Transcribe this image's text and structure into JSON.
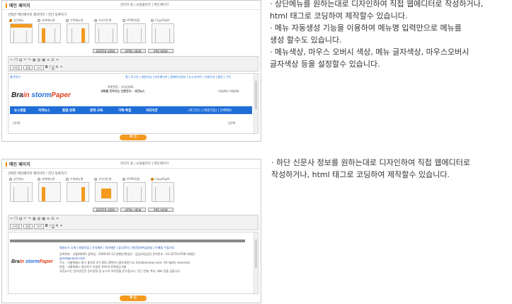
{
  "screenshots": [
    {
      "title": "메인 페이지",
      "breadcrumb": "관리자 홈 | 쇼핑몰관리 | 메인페이지",
      "subtitle": "선택한 메인페이지 레이아웃 / 전단 등록하기",
      "templates": [
        {
          "label": "상단메뉴",
          "selected": true
        },
        {
          "label": "좌측메뉴형",
          "selected": false
        },
        {
          "label": "우측메뉴형",
          "selected": false
        },
        {
          "label": "기사하단형",
          "selected": false
        },
        {
          "label": "HTML편집",
          "selected": false
        },
        {
          "label": "CopyRight",
          "selected": false
        }
      ],
      "tabs": [
        "EDITER VIEW",
        "HTML VIEW",
        "PRE VIEW"
      ],
      "toolbar": {
        "font": "스타일",
        "face": "굴림",
        "size": "크기"
      },
      "preview": {
        "left_link": "즐겨찾기",
        "top_links": "홈 | 로그인 | 회원가입 | 마이페이지 | 홈페이지정보 | 뉴스사이트 | 이용안내 | 웹진 | 구독",
        "tagline_line1": "최종편집 : (오늘날짜)",
        "tagline_line2": "새해를 전하자는 언론전자 - 국민뉴스",
        "right_info": "(새날짜)   (새날짜)",
        "menu": [
          "뉴스종합",
          "지역뉴스",
          "칼럼·연재",
          "문화·교육",
          "기획·특집",
          "국민의견"
        ],
        "menu_right": "(로그인) | (회원가입) | 전체메뉴",
        "footer_left": "(순위)",
        "footer_right": "(검색)"
      },
      "ok_label": "확 인"
    },
    {
      "title": "메인 페이지",
      "breadcrumb": "관리자 홈 | 쇼핑몰관리 | 메인페이지",
      "subtitle": "선택한 메인페이지 레이아웃 / 전단 등록하기",
      "templates": [
        {
          "label": "상단메뉴",
          "selected": false
        },
        {
          "label": "좌측메뉴형",
          "selected": false
        },
        {
          "label": "우측메뉴형",
          "selected": false
        },
        {
          "label": "기사하단형",
          "selected": false
        },
        {
          "label": "HTML편집",
          "selected": false
        },
        {
          "label": "CopyRight",
          "selected": true
        }
      ],
      "tabs": [
        "EDITER VIEW",
        "HTML VIEW",
        "PRE VIEW"
      ],
      "toolbar": {
        "font": "스타일",
        "face": "굴림",
        "size": "크기"
      },
      "preview": {
        "footer_links": "회원뉴스 소개 | 회원모집 | 기사제보 | 독자제안 | 광고문의 | 개인정보취급방침 | 이메일 수집거부",
        "info1": "등록번호 : 서울00001  등록일 : 2009-05-12  발행인/편집인 : 김담비/김성전  문자번호 : 02-2276-6768  이메일 :",
        "info2": "gsnet@naver.com",
        "info3": "주소 : 서울특별시 중구 충무로 4가 261-29번지 (충무회관) (c) Gsnbionnews.com. All rights reserved.",
        "info4": "본점 : 서울특별시 용산로구 모정동 459-4 만화빌딩 4층",
        "info5": "국민뉴스는 인터넷신문 윤리강령 및 뉴스의 저작권을 준수합니다. 무단 전재, 복사, 배포 등을 금합니다."
      },
      "ok_label": "확 인"
    }
  ],
  "logo": {
    "brain": "Bra",
    "in": "in",
    "storm": "storm",
    "paper": "Paper"
  },
  "descriptions": {
    "block1": [
      "· 상단메뉴를 원하는대로 디자인하여 직접 웹에디터로 작성하거나,",
      "html 태그로 코딩하여 제작할수 있습니다.",
      "· 메뉴 자동생성 기능을 이용하여 메뉴명 입력만으로 메뉴를",
      "생성 할수도 있습니다.",
      "· 메뉴색상, 마우스 오버시 색상, 메뉴 글자색상, 마우스오버시",
      "글자색상 등을 설정할수 있습니다."
    ],
    "block2": [
      "· 하단 신문사 정보를 원하는대로 디자인하여 직접 웹에디터로",
      "작성하거나, html 태그로 코딩하여 제작할수 있습니다."
    ]
  },
  "colors": {
    "accent": "#f39a1f",
    "menu_bg": "#1f6ed8",
    "logo_red": "#e3401f"
  }
}
